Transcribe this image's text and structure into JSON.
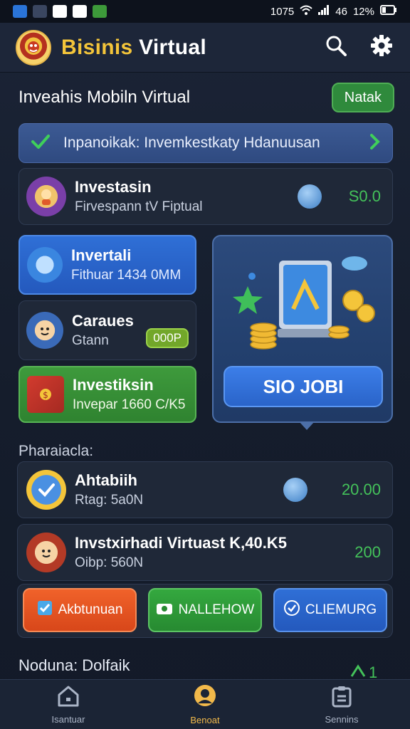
{
  "status_bar": {
    "time": "1075",
    "battery": "12%",
    "network": "46"
  },
  "app": {
    "title_part1": "Bisinis",
    "title_part2": "Virtual"
  },
  "section": {
    "title": "Inveahis Mobiln Virtual",
    "action_label": "Natak"
  },
  "banner": {
    "text": "Inpanoikak: Invemkestkaty Hdanuusan"
  },
  "top_card": {
    "title": "Investasin",
    "subtitle": "Firvespann tV Fiptual",
    "amount": "S0.0"
  },
  "tiles": [
    {
      "title": "Invertali",
      "subtitle": "Fithuar 1434 0MM"
    },
    {
      "title": "Caraues",
      "subtitle": "Gtann",
      "badge": "000P"
    },
    {
      "title": "Investiksin",
      "subtitle": "Invepar 1660 C/K5"
    }
  ],
  "promo": {
    "button_label": "SIO JOBI"
  },
  "list_label": "Pharaiacla:",
  "list_items": [
    {
      "title": "Ahtabiih",
      "subtitle": "Rtag: 5a0N",
      "amount": "20.00"
    },
    {
      "title": "Invstxirhadi Virtuast K,40.K5",
      "subtitle": "Oibp: 560N",
      "amount": "200"
    }
  ],
  "actions": [
    {
      "label": "Akbtunuan",
      "color": "#e8531f"
    },
    {
      "label": "NALLEHOW",
      "color": "#2f9a3a"
    },
    {
      "label": "CLIEMURG",
      "color": "#2966cf"
    }
  ],
  "footer_label": "Noduna: Dolfaik",
  "footer_value": "1",
  "nav": [
    {
      "label": "Isantuar",
      "icon": "home-icon"
    },
    {
      "label": "Benoat",
      "icon": "profile-icon"
    },
    {
      "label": "Sennins",
      "icon": "clipboard-icon"
    }
  ],
  "colors": {
    "accent_green": "#44c25a",
    "brand_yellow": "#f4c53a",
    "primary_blue": "#2f6fd6"
  }
}
